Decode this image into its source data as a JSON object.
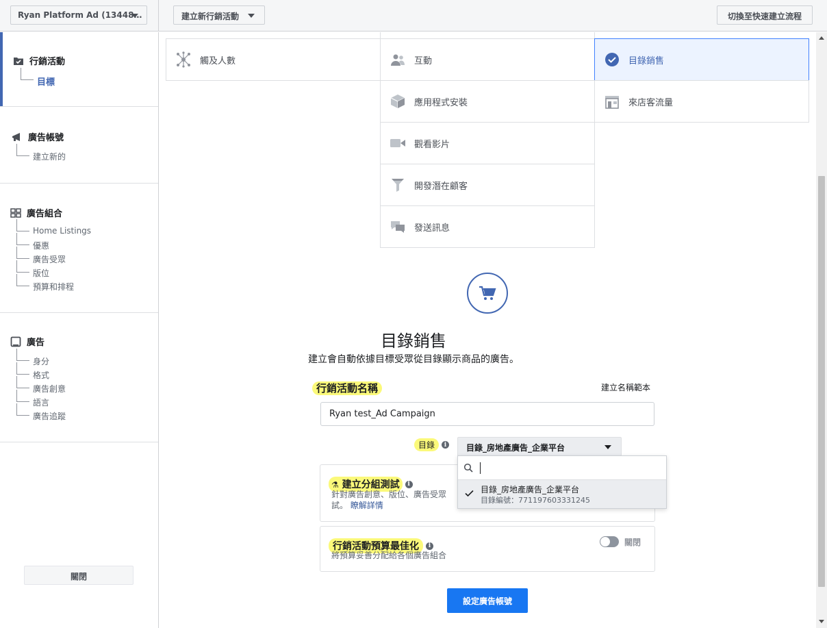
{
  "topbar": {
    "account_label": "Ryan Platform Ad (13448…",
    "new_campaign_label": "建立新行銷活動",
    "quick_flow_label": "切換至快速建立流程"
  },
  "sidebar": {
    "campaign": {
      "title": "行銷活動",
      "items": [
        "目標"
      ]
    },
    "ad_account": {
      "title": "廣告帳號",
      "items": [
        "建立新的"
      ]
    },
    "ad_set": {
      "title": "廣告組合",
      "items": [
        "Home Listings",
        "優惠",
        "廣告受眾",
        "版位",
        "預算和排程"
      ]
    },
    "ad": {
      "title": "廣告",
      "items": [
        "身分",
        "格式",
        "廣告創意",
        "語言",
        "廣告追蹤"
      ]
    },
    "close_label": "關閉"
  },
  "objectives": {
    "reach": "觸及人數",
    "engagement": "互動",
    "catalog_sales": "目錄銷售",
    "app_installs": "應用程式安裝",
    "store_traffic": "來店客流量",
    "video_views": "觀看影片",
    "lead_generation": "開發潛在顧客",
    "messages": "發送訊息"
  },
  "selected": {
    "title": "目錄銷售",
    "description": "建立會自動依據目標受眾從目錄顯示商品的廣告。"
  },
  "form": {
    "campaign_name_label": "行銷活動名稱",
    "name_template_link": "建立名稱範本",
    "campaign_name_value": "Ryan test_Ad Campaign",
    "catalog_label": "目錄",
    "catalog_selected": "目錄_房地產廣告_企業平台",
    "split_test_title": "建立分組測試",
    "split_test_desc_line1": "針對廣告創意、版位、廣告受眾",
    "split_test_desc_line2": "試。",
    "learn_more": "瞭解詳情",
    "cbo_title": "行銷活動預算最佳化",
    "cbo_desc": "將預算妥善分配給各個廣告組合",
    "cbo_toggle_label": "關閉",
    "submit_label": "設定廣告帳號"
  },
  "catalog_dropdown": {
    "search_value": "",
    "option_name": "目錄_房地產廣告_企業平台",
    "option_id": "目錄編號：771197603331245"
  },
  "colors": {
    "accent": "#4267b2",
    "primary_button": "#1877f2",
    "highlight": "#fbf97a"
  }
}
